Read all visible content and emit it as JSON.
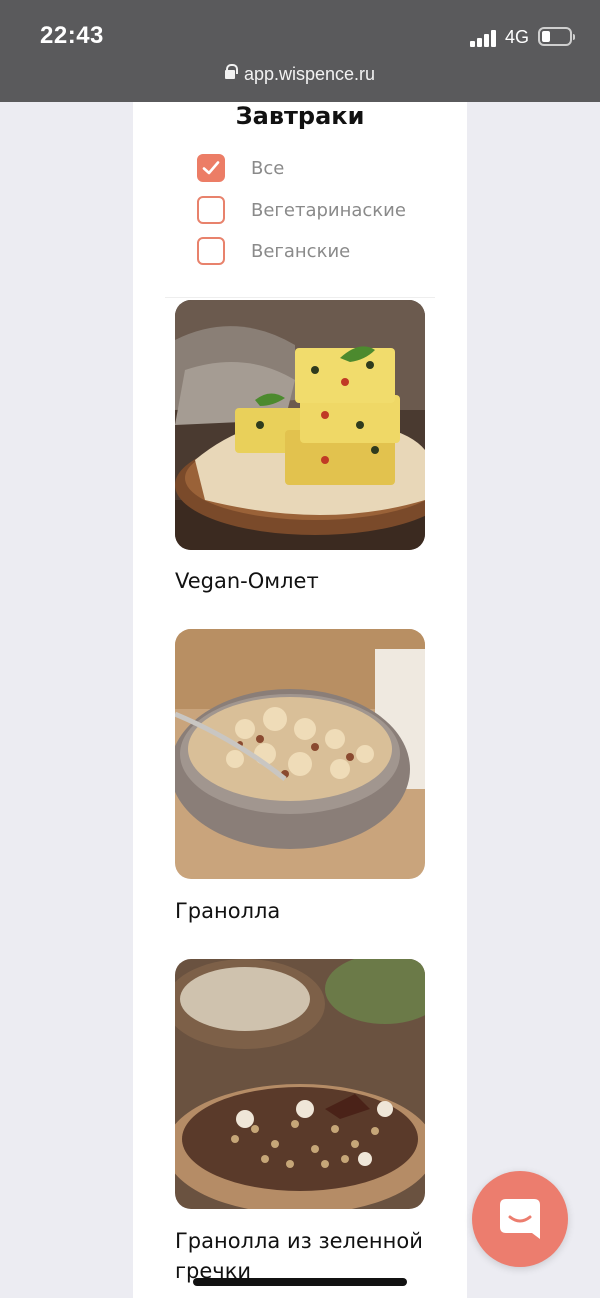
{
  "status_bar": {
    "time": "22:43",
    "network": "4G"
  },
  "browser": {
    "url": "app.wispence.ru"
  },
  "page": {
    "title": "Завтраки",
    "filters": [
      {
        "label": "Все",
        "checked": true
      },
      {
        "label": "Вегетаринаские",
        "checked": false
      },
      {
        "label": "Веганские",
        "checked": false
      }
    ],
    "recipes": [
      {
        "title": "Vegan-Омлет"
      },
      {
        "title": "Гранолла"
      },
      {
        "title": "Гранолла из зеленной гречки"
      }
    ]
  },
  "colors": {
    "accent": "#ec7d66",
    "status_bar": "#5a5a5c",
    "background": "#ececf2"
  },
  "icons": {
    "chat": "chat-bubble-icon",
    "lock": "lock-icon",
    "check": "check-icon"
  }
}
